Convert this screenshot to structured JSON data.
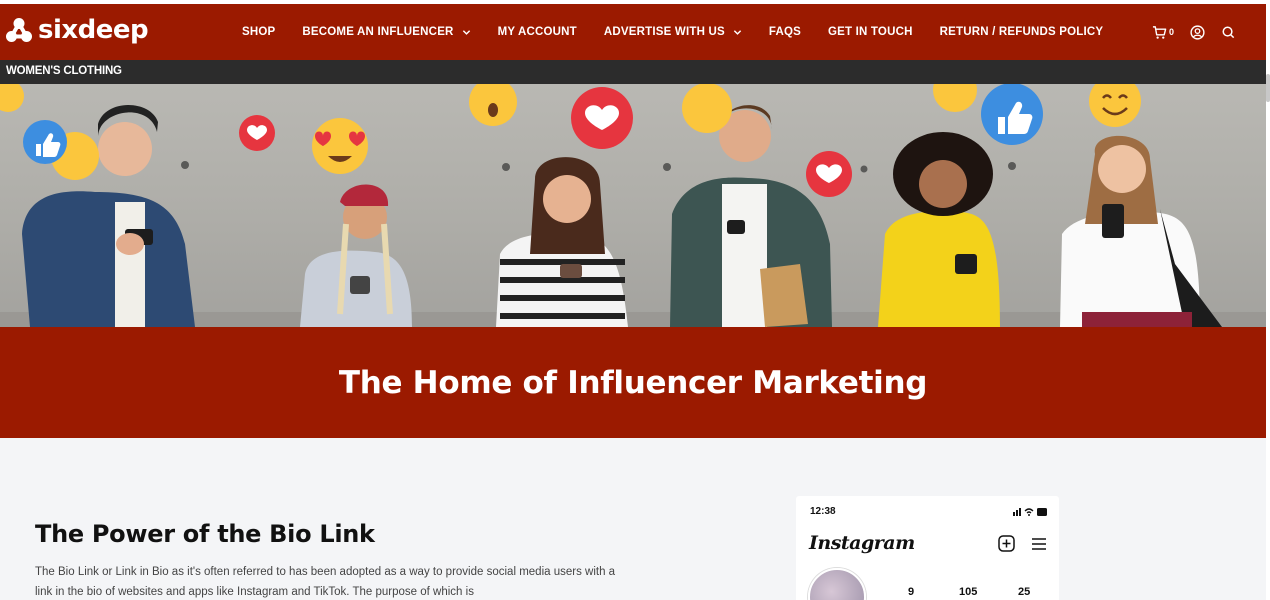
{
  "brand": {
    "name": "sixdeep"
  },
  "nav": {
    "items": [
      {
        "label": "SHOP",
        "has_dropdown": false
      },
      {
        "label": "BECOME AN INFLUENCER",
        "has_dropdown": true
      },
      {
        "label": "MY ACCOUNT",
        "has_dropdown": false
      },
      {
        "label": "ADVERTISE WITH US",
        "has_dropdown": true
      },
      {
        "label": "FAQS",
        "has_dropdown": false
      },
      {
        "label": "GET IN TOUCH",
        "has_dropdown": false
      },
      {
        "label": "RETURN / REFUNDS POLICY",
        "has_dropdown": false
      }
    ]
  },
  "header_icons": {
    "cart_count": "0",
    "icons": [
      "cart-icon",
      "account-icon",
      "search-icon"
    ]
  },
  "subbar": {
    "label": "WOMEN'S CLOTHING"
  },
  "banner": {
    "title": "The Home of Influencer Marketing"
  },
  "section": {
    "title": "The Power of the Bio Link",
    "body": "The Bio Link or Link in Bio as it's often referred to has been adopted as a way to provide social media users with a link in the bio of websites and apps like Instagram and TikTok.  The purpose of which is"
  },
  "phone_card": {
    "time": "12:38",
    "app": "Instagram",
    "stats": [
      "9",
      "105",
      "25"
    ]
  },
  "colors": {
    "brand_red": "#9b1a00",
    "subbar": "#2c2c2c",
    "page_bg": "#f4f5f7"
  }
}
